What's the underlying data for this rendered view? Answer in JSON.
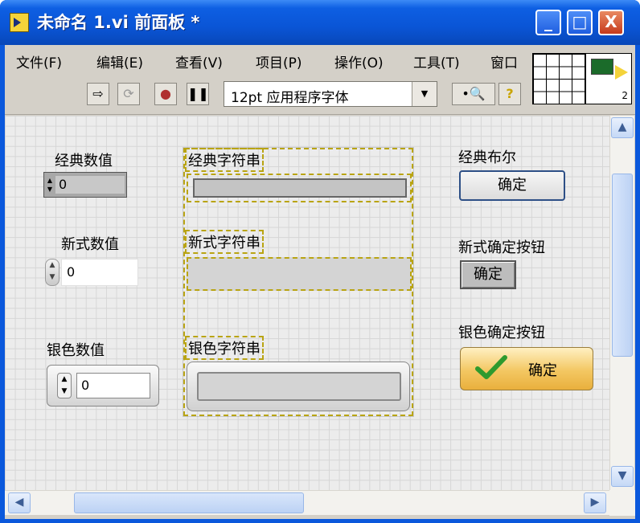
{
  "window": {
    "title": "未命名 1.vi 前面板 *"
  },
  "caption_buttons": {
    "minimize": "_",
    "maximize": "□",
    "close": "X"
  },
  "menu": [
    "文件(F)",
    "编辑(E)",
    "查看(V)",
    "项目(P)",
    "操作(O)",
    "工具(T)",
    "窗口"
  ],
  "toolbar": {
    "font_selector": "12pt 应用程序字体"
  },
  "vi_icon": {
    "connector_count": "2"
  },
  "controls": {
    "classic_numeric": {
      "label": "经典数值",
      "value": "0"
    },
    "modern_numeric": {
      "label": "新式数值",
      "value": "0"
    },
    "silver_numeric": {
      "label": "银色数值",
      "value": "0"
    },
    "classic_string": {
      "label": "经典字符串",
      "value": ""
    },
    "modern_string": {
      "label": "新式字符串",
      "value": ""
    },
    "silver_string": {
      "label": "银色字符串",
      "value": ""
    },
    "classic_boolean": {
      "label": "经典布尔",
      "button": "确定"
    },
    "modern_ok_button": {
      "label": "新式确定按钮",
      "button": "确定"
    },
    "silver_ok_button": {
      "label": "银色确定按钮",
      "button": "确定"
    }
  },
  "colors": {
    "titlebar": "#0a55d6",
    "panel_grid": "#ececec",
    "selection": "#b9a413",
    "silver_button": "#f3c762"
  }
}
